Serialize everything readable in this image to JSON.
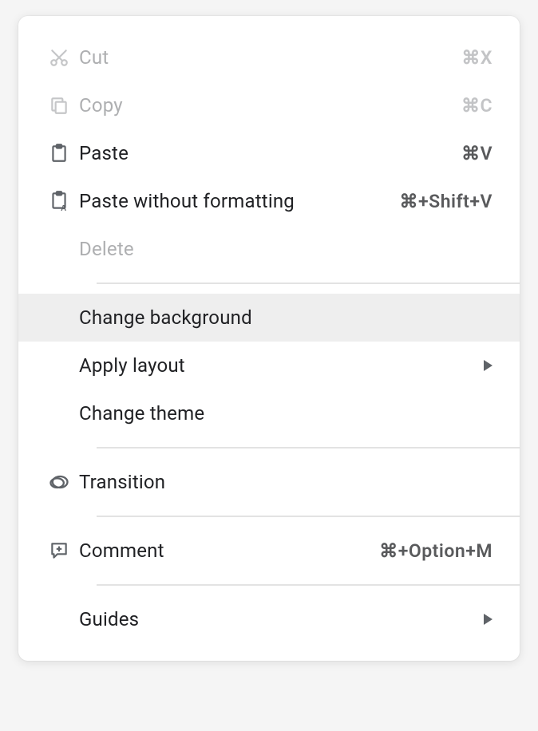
{
  "menu": {
    "items": [
      {
        "label": "Cut",
        "shortcut": "⌘X"
      },
      {
        "label": "Copy",
        "shortcut": "⌘C"
      },
      {
        "label": "Paste",
        "shortcut": "⌘V"
      },
      {
        "label": "Paste without formatting",
        "shortcut": "⌘+Shift+V"
      },
      {
        "label": "Delete"
      },
      {
        "label": "Change background"
      },
      {
        "label": "Apply layout"
      },
      {
        "label": "Change theme"
      },
      {
        "label": "Transition"
      },
      {
        "label": "Comment",
        "shortcut": "⌘+Option+M"
      },
      {
        "label": "Guides"
      }
    ]
  }
}
